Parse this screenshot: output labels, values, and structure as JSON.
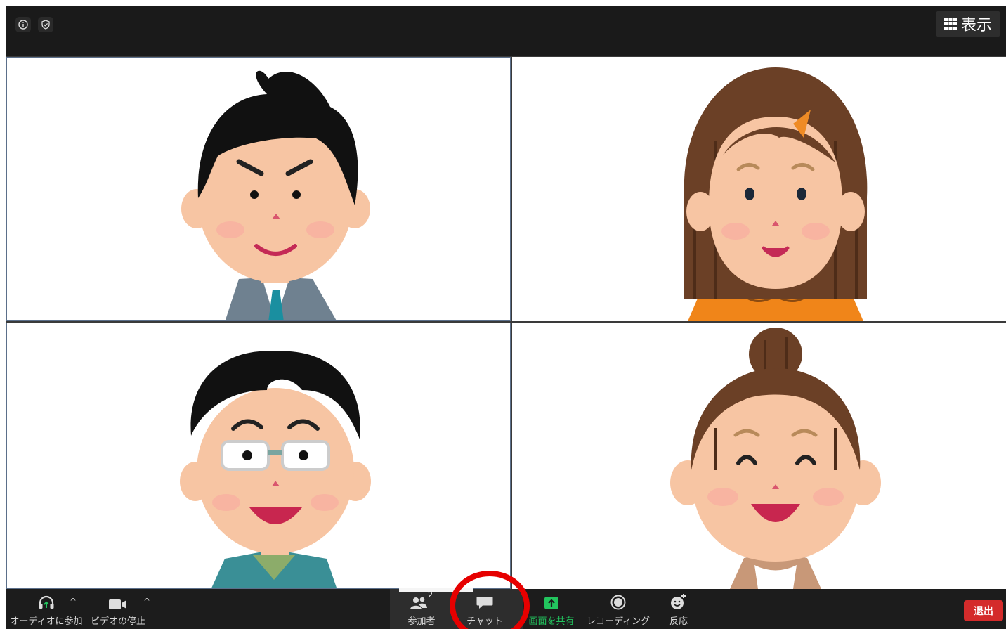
{
  "window": {
    "top_bar": {
      "view_button_label": "表示",
      "left_icons": [
        "info-icon",
        "shield-check-icon"
      ]
    }
  },
  "participants": [
    {
      "avatar": "man-suit-icon"
    },
    {
      "avatar": "woman-long-hair-icon"
    },
    {
      "avatar": "man-glasses-icon"
    },
    {
      "avatar": "woman-bun-icon"
    }
  ],
  "toolbar": {
    "audio_label": "オーディオに参加",
    "video_label": "ビデオの停止",
    "participants_label": "参加者",
    "participants_count": "2",
    "chat_label": "チャット",
    "share_label": "画面を共有",
    "record_label": "レコーディング",
    "reaction_label": "反応",
    "leave_label": "退出"
  },
  "colors": {
    "toolbar_bg": "#1c1c1c",
    "share_accent": "#22c55e",
    "leave_button": "#d42b2b",
    "annotation_circle": "#e60000"
  }
}
